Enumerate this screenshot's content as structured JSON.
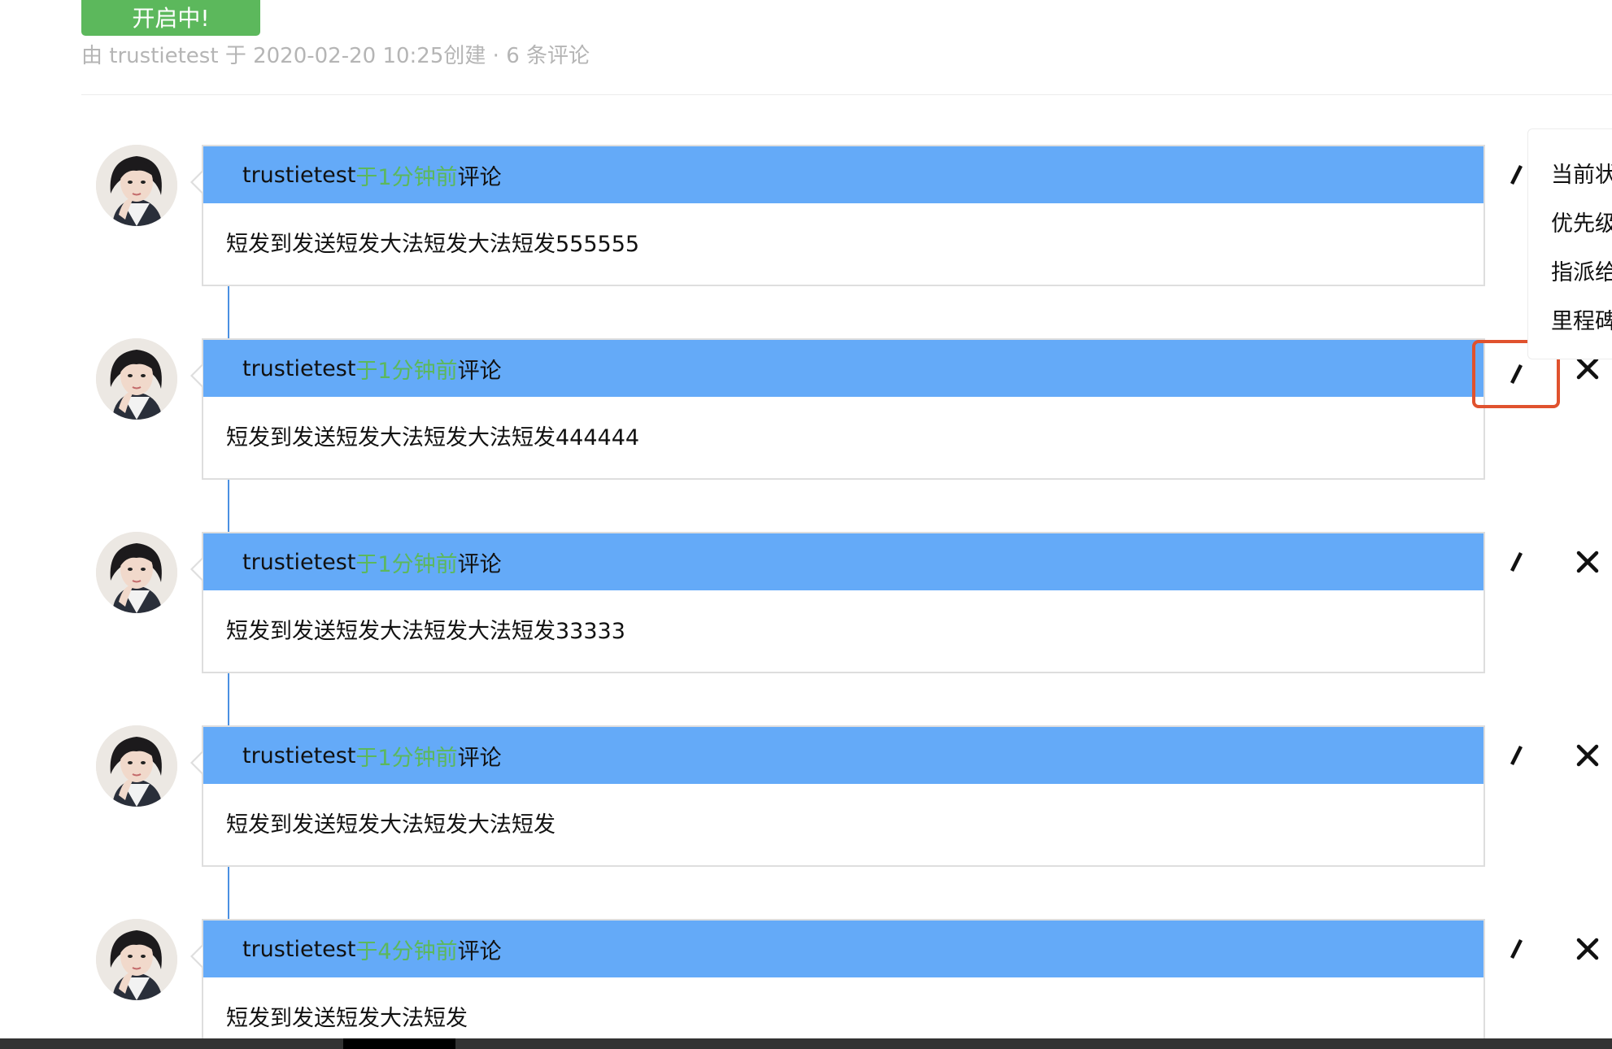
{
  "header": {
    "status_button": "开启中!",
    "meta": {
      "prefix": "由",
      "author": "trustietest",
      "conj": "于",
      "datetime": "2020-02-20 10:25创建",
      "separator": "·",
      "comment_count": "6 条评论"
    }
  },
  "comments": [
    {
      "author": "trustietest",
      "time": "于1分钟前",
      "verb": "评论",
      "body": "短发到发送短发大法短发大法短发555555"
    },
    {
      "author": "trustietest",
      "time": "于1分钟前",
      "verb": "评论",
      "body": "短发到发送短发大法短发大法短发444444"
    },
    {
      "author": "trustietest",
      "time": "于1分钟前",
      "verb": "评论",
      "body": "短发到发送短发大法短发大法短发33333"
    },
    {
      "author": "trustietest",
      "time": "于1分钟前",
      "verb": "评论",
      "body": "短发到发送短发大法短发大法短发"
    },
    {
      "author": "trustietest",
      "time": "于4分钟前",
      "verb": "评论",
      "body": "短发到发送短发大法短发"
    }
  ],
  "side_panel": {
    "items": [
      "当前状",
      "优先级",
      "指派给",
      "里程碑"
    ]
  },
  "icons": {
    "edit": "pencil-icon",
    "delete": "close-icon"
  },
  "colors": {
    "header_bar": "#64aaf8",
    "timeline": "#4a90e2",
    "status_green": "#5cb85c",
    "highlight": "#e0522e"
  }
}
